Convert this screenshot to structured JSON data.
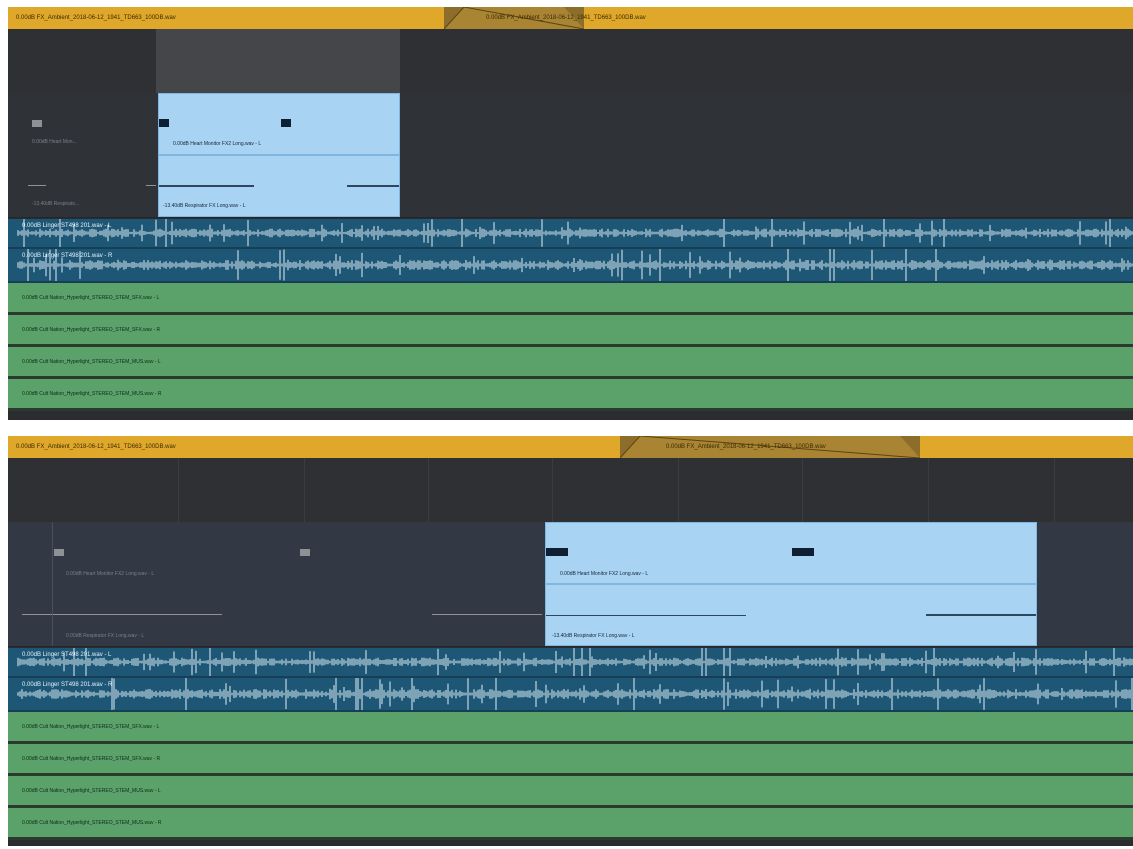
{
  "panels": [
    {
      "id": "top",
      "video_clips": [
        {
          "label": "0.00dB   FX_Ambient_2018-06-12_1941_TD663_100DB.wav"
        },
        {
          "label": "0.00dB   FX_Ambient_2018-06-12_1941_TD663_100DB.wav"
        }
      ],
      "ghost_tracks": [
        {
          "label": "0.00dB   Heart Mon..."
        },
        {
          "label": "-13.40dB   Respirato..."
        }
      ],
      "light_clips": [
        {
          "label": "0.00dB    Heart Monitor FX2 Long.wav - L"
        },
        {
          "label": "-13.40dB    Respirator FX Long.wav - L"
        }
      ],
      "blue_tracks": [
        {
          "label": "0.00dB    Linger ST498 201.wav - L"
        },
        {
          "label": "0.00dB    Linger ST498 201.wav - R"
        }
      ],
      "green_tracks": [
        {
          "label": "0.00dB    Cult Nation_Hyperlight_STEREO_STEM_SFX.wav - L"
        },
        {
          "label": "0.00dB    Cult Nation_Hyperlight_STEREO_STEM_SFX.wav - R"
        },
        {
          "label": "0.00dB    Cult Nation_Hyperlight_STEREO_STEM_MUS.wav - L"
        },
        {
          "label": "0.00dB    Cult Nation_Hyperlight_STEREO_STEM_MUS.wav - R"
        }
      ]
    },
    {
      "id": "bottom",
      "video_clips": [
        {
          "label": "0.00dB   FX_Ambient_2018-06-12_1941_TD663_100DB.wav"
        },
        {
          "label": "0.00dB   FX_Ambient_2018-06-12_1941_TD663_100DB.wav"
        }
      ],
      "ghost_tracks": [
        {
          "label": "0.00dB   Heart Monitor FX2 Long.wav - L"
        },
        {
          "label": "0.00dB   Respirator FX Long.wav - L"
        }
      ],
      "light_clips": [
        {
          "label": "0.00dB    Heart Monitor FX2 Long.wav - L"
        },
        {
          "label": "-13.40dB    Respirator FX Long.wav - L"
        }
      ],
      "blue_tracks": [
        {
          "label": "0.00dB    Linger ST498 201.wav - L"
        },
        {
          "label": "0.00dB    Linger ST498 201.wav - R"
        }
      ],
      "green_tracks": [
        {
          "label": "0.00dB    Cult Nation_Hyperlight_STEREO_STEM_SFX.wav - L"
        },
        {
          "label": "0.00dB    Cult Nation_Hyperlight_STEREO_STEM_SFX.wav - R"
        },
        {
          "label": "0.00dB    Cult Nation_Hyperlight_STEREO_STEM_MUS.wav - L"
        },
        {
          "label": "0.00dB    Cult Nation_Hyperlight_STEREO_STEM_MUS.wav - R"
        }
      ]
    }
  ],
  "colors": {
    "video_track": "#e0a82a",
    "audio_clip_selected": "#a9d3f2",
    "audio_track_blue": "#1e5776",
    "audio_track_green": "#5aa26a",
    "timeline_bg": "#2b2c2f"
  }
}
